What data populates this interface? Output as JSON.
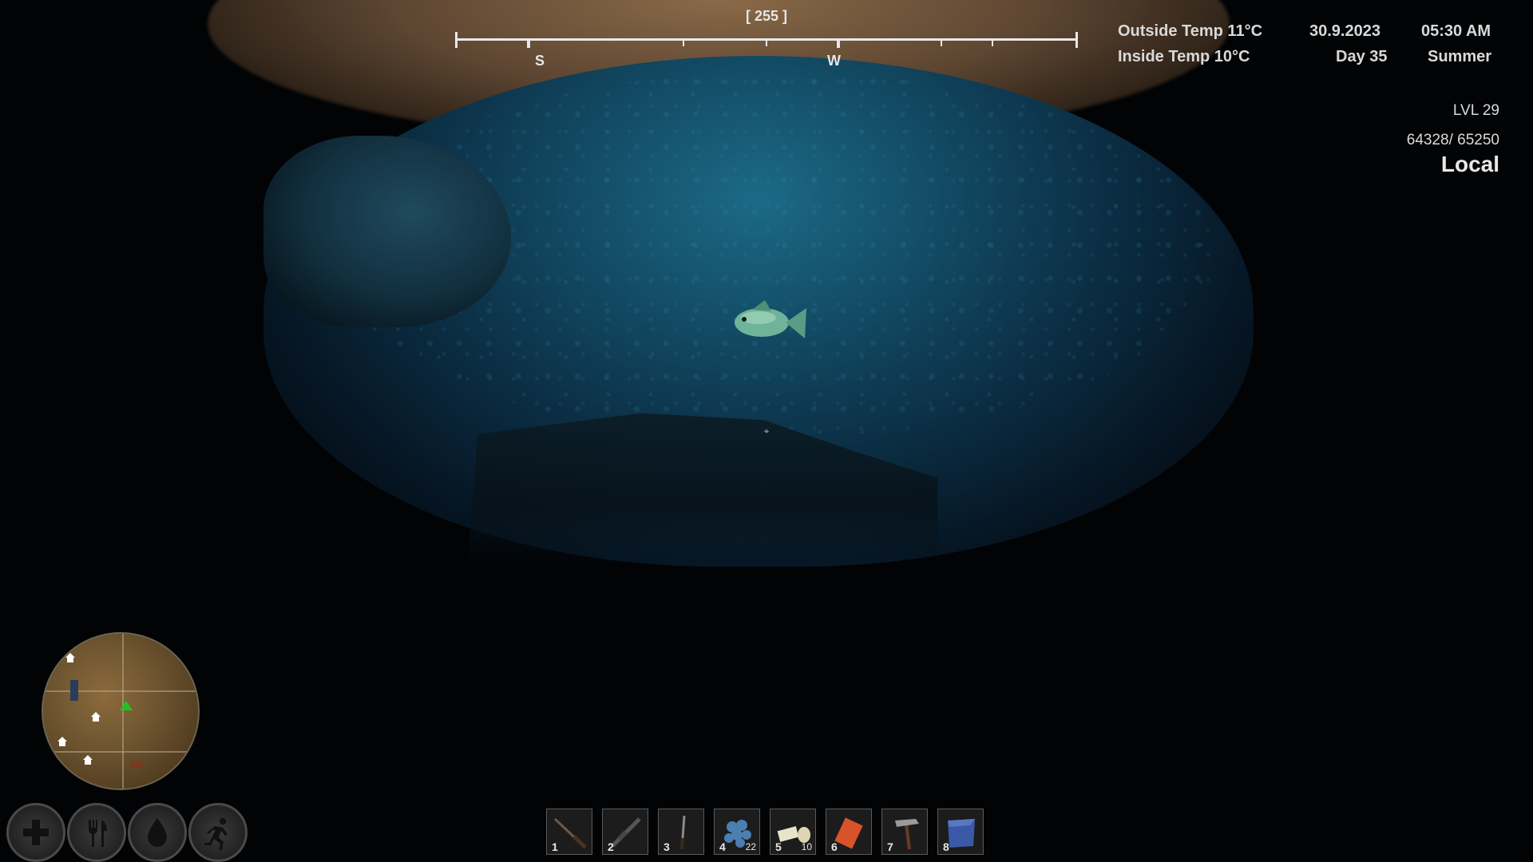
{
  "compass": {
    "heading": "[ 255 ]",
    "directions": [
      "S",
      "W"
    ]
  },
  "environment": {
    "outside_temp": "Outside Temp 11°C",
    "inside_temp": "Inside Temp 10°C",
    "date": "30.9.2023",
    "day": "Day 35",
    "time": "05:30 AM",
    "season": "Summer"
  },
  "player": {
    "level": "LVL 29",
    "xp": "64328/ 65250",
    "server": "Local"
  },
  "status_icons": [
    "health-icon",
    "hunger-icon",
    "thirst-icon",
    "stamina-icon"
  ],
  "hotbar": [
    {
      "num": "1",
      "item": "hunting-rifle-icon",
      "qty": ""
    },
    {
      "num": "2",
      "item": "assault-rifle-icon",
      "qty": ""
    },
    {
      "num": "3",
      "item": "knife-icon",
      "qty": ""
    },
    {
      "num": "4",
      "item": "blueberries-icon",
      "qty": "22"
    },
    {
      "num": "5",
      "item": "bandage-icon",
      "qty": "10"
    },
    {
      "num": "6",
      "item": "flare-icon",
      "qty": ""
    },
    {
      "num": "7",
      "item": "hammer-icon",
      "qty": ""
    },
    {
      "num": "8",
      "item": "map-icon",
      "qty": ""
    }
  ],
  "colors": {
    "hud_text": "#d9d9d9",
    "water_glow": "#1c6a86",
    "player_marker": "#22c21e"
  }
}
